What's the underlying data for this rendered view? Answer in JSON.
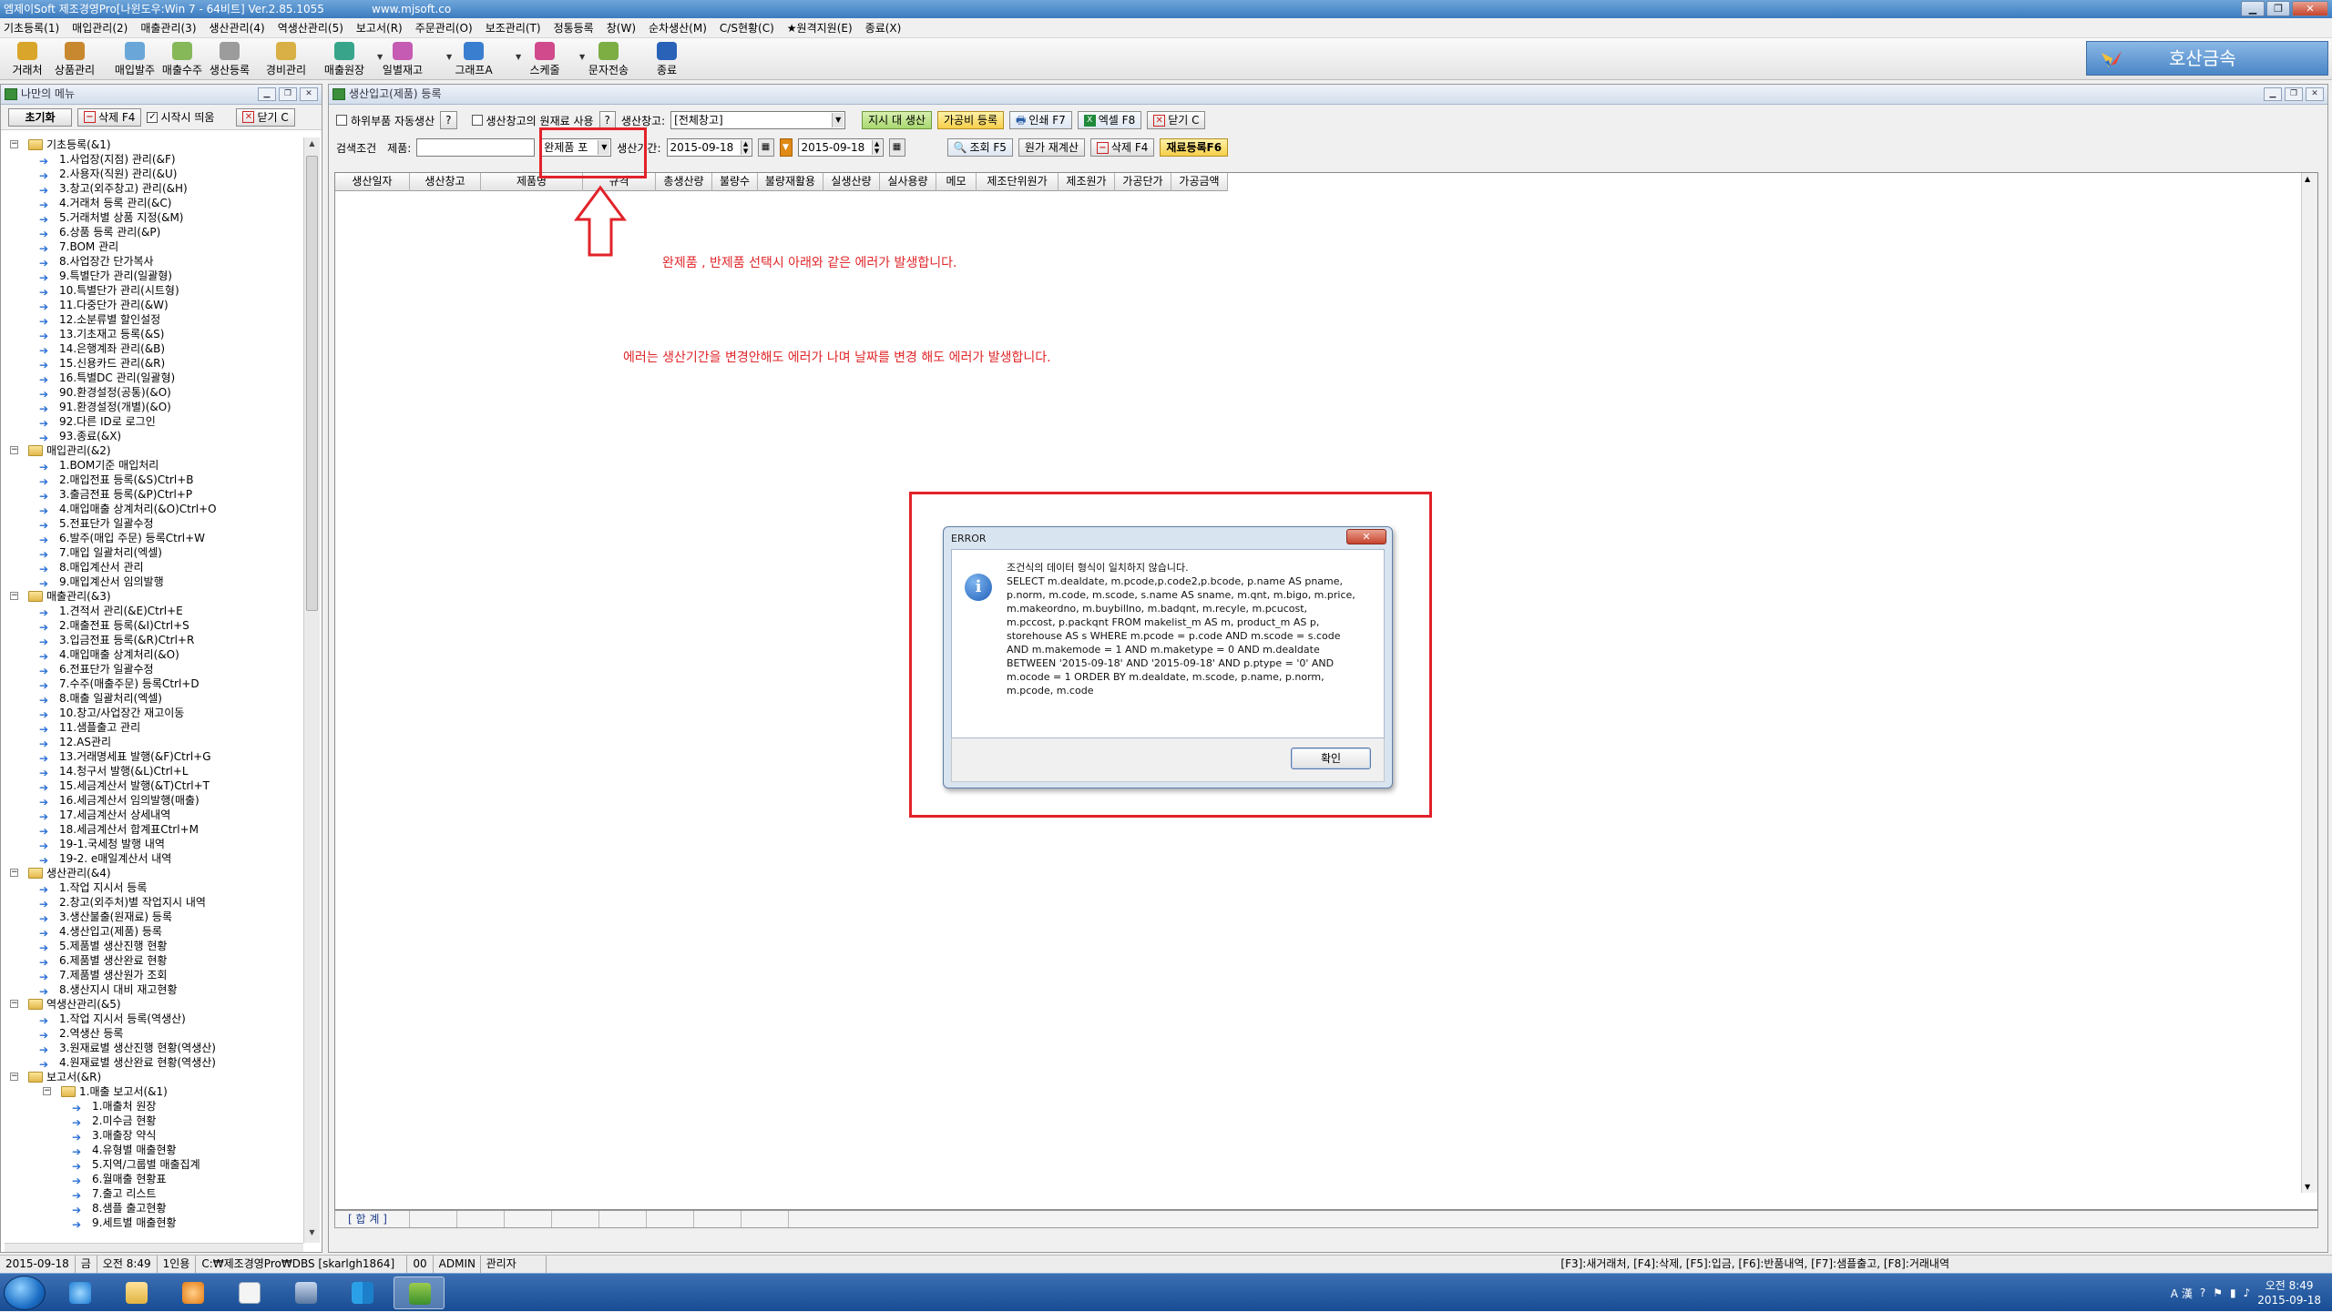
{
  "titlebar": {
    "title": "엠제이Soft 제조경영Pro[나윈도우:Win 7 - 64비트]  Ver.2.85.1055",
    "url": "www.mjsoft.co"
  },
  "menu": [
    "기초등록(1)",
    "매입관리(2)",
    "매출관리(3)",
    "생산관리(4)",
    "역생산관리(5)",
    "보고서(R)",
    "주문관리(O)",
    "보조관리(T)",
    "정통등록",
    "창(W)",
    "순차생산(M)",
    "C/S현황(C)",
    "★원격지원(E)",
    "종료(X)"
  ],
  "toolbar": {
    "buttons": [
      {
        "label": "거래처",
        "icon": "handshake-icon",
        "color": "#d9a52a"
      },
      {
        "label": "상품관리",
        "icon": "box-icon",
        "color": "#c8882f"
      },
      {
        "label": "매입발주",
        "icon": "purchase-icon",
        "color": "#6aa7d8"
      },
      {
        "label": "매출수주",
        "icon": "sales-icon",
        "color": "#86b85a"
      },
      {
        "label": "생산등록",
        "icon": "production-icon",
        "color": "#9c9c9c"
      },
      {
        "label": "경비관리",
        "icon": "expense-icon",
        "color": "#d8b046"
      },
      {
        "label": "매출원장",
        "icon": "ledger-icon",
        "color": "#38a58a"
      },
      {
        "label": "일별재고",
        "icon": "inventory-icon",
        "color": "#c55bb3"
      },
      {
        "label": "그래프A",
        "icon": "graph-icon",
        "color": "#3a7ed0"
      },
      {
        "label": "스케줄",
        "icon": "schedule-icon",
        "color": "#d04a8c"
      },
      {
        "label": "문자전송",
        "icon": "sms-icon",
        "color": "#7cae44"
      },
      {
        "label": "종료",
        "icon": "exit-icon",
        "color": "#2a62b8"
      }
    ],
    "company": "호산금속"
  },
  "leftpanel": {
    "title": "나만의 메뉴",
    "reset_label": "초기화",
    "delete_label": "삭제 F4",
    "startup_label": "시작시 띄움",
    "close_label": "닫기 C"
  },
  "tree": [
    {
      "d": 0,
      "t": "기초등록(&1)",
      "f": 1,
      "e": "−"
    },
    {
      "d": 1,
      "t": "1.사업장(지점) 관리(&F)"
    },
    {
      "d": 1,
      "t": "2.사용자(직원) 관리(&U)"
    },
    {
      "d": 1,
      "t": "3.창고(외주창고) 관리(&H)"
    },
    {
      "d": 1,
      "t": "4.거래처 등록 관리(&C)"
    },
    {
      "d": 1,
      "t": "5.거래처별 상품 지정(&M)"
    },
    {
      "d": 1,
      "t": "6.상품 등록 관리(&P)"
    },
    {
      "d": 1,
      "t": "7.BOM 관리"
    },
    {
      "d": 1,
      "t": "8.사업장간 단가복사"
    },
    {
      "d": 1,
      "t": "9.특별단가 관리(일괄형)"
    },
    {
      "d": 1,
      "t": "10.특별단가 관리(시트형)"
    },
    {
      "d": 1,
      "t": "11.다중단가 관리(&W)"
    },
    {
      "d": 1,
      "t": "12.소분류별 할인설정"
    },
    {
      "d": 1,
      "t": "13.기초재고 등록(&S)"
    },
    {
      "d": 1,
      "t": "14.은행계좌 관리(&B)"
    },
    {
      "d": 1,
      "t": "15.신용카드 관리(&R)"
    },
    {
      "d": 1,
      "t": "16.특별DC 관리(일괄형)"
    },
    {
      "d": 1,
      "t": "90.환경설정(공통)(&O)"
    },
    {
      "d": 1,
      "t": "91.환경설정(개별)(&O)"
    },
    {
      "d": 1,
      "t": "92.다른 ID로 로그인"
    },
    {
      "d": 1,
      "t": "93.종료(&X)"
    },
    {
      "d": 0,
      "t": "매입관리(&2)",
      "f": 1,
      "e": "−"
    },
    {
      "d": 1,
      "t": "1.BOM기준 매입처리"
    },
    {
      "d": 1,
      "t": "2.매입전표 등록(&S)Ctrl+B"
    },
    {
      "d": 1,
      "t": "3.출금전표 등록(&P)Ctrl+P"
    },
    {
      "d": 1,
      "t": "4.매입매출 상계처리(&O)Ctrl+O"
    },
    {
      "d": 1,
      "t": "5.전표단가 일괄수정"
    },
    {
      "d": 1,
      "t": "6.발주(매입 주문) 등록Ctrl+W"
    },
    {
      "d": 1,
      "t": "7.매입 일괄처리(엑셀)"
    },
    {
      "d": 1,
      "t": "8.매입계산서 관리"
    },
    {
      "d": 1,
      "t": "9.매입계산서 임의발행"
    },
    {
      "d": 0,
      "t": "매출관리(&3)",
      "f": 1,
      "e": "−"
    },
    {
      "d": 1,
      "t": "1.견적서 관리(&E)Ctrl+E"
    },
    {
      "d": 1,
      "t": "2.매출전표 등록(&I)Ctrl+S"
    },
    {
      "d": 1,
      "t": "3.입금전표 등록(&R)Ctrl+R"
    },
    {
      "d": 1,
      "t": "4.매입매출 상계처리(&O)"
    },
    {
      "d": 1,
      "t": "6.전표단가 일괄수정"
    },
    {
      "d": 1,
      "t": "7.수주(매출주문) 등록Ctrl+D"
    },
    {
      "d": 1,
      "t": "8.매출 일괄처리(엑셀)"
    },
    {
      "d": 1,
      "t": "10.창고/사업장간 재고이동"
    },
    {
      "d": 1,
      "t": "11.샘플출고 관리"
    },
    {
      "d": 1,
      "t": "12.AS관리"
    },
    {
      "d": 1,
      "t": "13.거래명세표 발행(&F)Ctrl+G"
    },
    {
      "d": 1,
      "t": "14.청구서 발행(&L)Ctrl+L"
    },
    {
      "d": 1,
      "t": "15.세금계산서 발행(&T)Ctrl+T"
    },
    {
      "d": 1,
      "t": "16.세금계산서 임의발행(매출)"
    },
    {
      "d": 1,
      "t": "17.세금계산서 상세내역"
    },
    {
      "d": 1,
      "t": "18.세금계산서 합계표Ctrl+M"
    },
    {
      "d": 1,
      "t": "19-1.국세청 발행 내역"
    },
    {
      "d": 1,
      "t": "19-2. e매일계산서 내역"
    },
    {
      "d": 0,
      "t": "생산관리(&4)",
      "f": 1,
      "e": "−"
    },
    {
      "d": 1,
      "t": "1.작업 지시서 등록"
    },
    {
      "d": 1,
      "t": "2.창고(외주처)별 작업지시 내역"
    },
    {
      "d": 1,
      "t": "3.생산불출(원재료) 등록"
    },
    {
      "d": 1,
      "t": "4.생산입고(제품) 등록"
    },
    {
      "d": 1,
      "t": "5.제품별 생산진행 현황"
    },
    {
      "d": 1,
      "t": "6.제품별 생산완료 현황"
    },
    {
      "d": 1,
      "t": "7.제품별 생산원가 조회"
    },
    {
      "d": 1,
      "t": "8.생산지시 대비 재고현황"
    },
    {
      "d": 0,
      "t": "역생산관리(&5)",
      "f": 1,
      "e": "−"
    },
    {
      "d": 1,
      "t": "1.작업 지시서 등록(역생산)"
    },
    {
      "d": 1,
      "t": "2.역생산 등록"
    },
    {
      "d": 1,
      "t": "3.원재료별 생산진행 현황(역생산)"
    },
    {
      "d": 1,
      "t": "4.원재료별 생산완료 현황(역생산)"
    },
    {
      "d": 0,
      "t": "보고서(&R)",
      "f": 1,
      "e": "−"
    },
    {
      "d": 1,
      "t": "1.매출 보고서(&1)",
      "f": 1,
      "e": "−"
    },
    {
      "d": 2,
      "t": "1.매출처 원장"
    },
    {
      "d": 2,
      "t": "2.미수금 현황"
    },
    {
      "d": 2,
      "t": "3.매출장 약식"
    },
    {
      "d": 2,
      "t": "4.유형별  매출현황"
    },
    {
      "d": 2,
      "t": "5.지역/그룹별 매출집계"
    },
    {
      "d": 2,
      "t": "6.월매출 현황표"
    },
    {
      "d": 2,
      "t": "7.출고 리스트"
    },
    {
      "d": 2,
      "t": "8.샘플 출고현황"
    },
    {
      "d": 2,
      "t": "9.세트별 매출현황"
    }
  ],
  "rightwin": {
    "title": "생산입고(제품) 등록",
    "sub_auto_label": "하위부품 자동생산",
    "q_label": "?",
    "warehouse_raw_label": "생산창고의 원재료 사용",
    "warehouse_label": "생산창고:",
    "warehouse_value": "[전체창고]",
    "btn_order_prod": "지시 대 생산",
    "btn_process_cost": "가공비 등록",
    "btn_print": "인쇄 F7",
    "btn_excel": "엑셀 F8",
    "btn_close": "닫기 C",
    "search_label": "검색조건",
    "product_label": "제품:",
    "product_type_value": "완제품 포",
    "period_label": "생산기간:",
    "date_from": "2015-09-18",
    "date_to": "2015-09-18",
    "btn_search": "조회 F5",
    "btn_recalc": "원가 재계산",
    "btn_delete": "삭제 F4",
    "btn_material": "재료등록F6"
  },
  "columns": [
    {
      "label": "생산일자",
      "w": 82
    },
    {
      "label": "생산창고",
      "w": 78
    },
    {
      "label": "제품명",
      "w": 112
    },
    {
      "label": "규격",
      "w": 80
    },
    {
      "label": "총생산량",
      "w": 62
    },
    {
      "label": "불량수",
      "w": 50
    },
    {
      "label": "불량재활용",
      "w": 72
    },
    {
      "label": "실생산량",
      "w": 62
    },
    {
      "label": "실사용량",
      "w": 62
    },
    {
      "label": "메모",
      "w": 44
    },
    {
      "label": "제조단위원가",
      "w": 90
    },
    {
      "label": "제조원가",
      "w": 62
    },
    {
      "label": "가공단가",
      "w": 62
    },
    {
      "label": "가공금액",
      "w": 62
    }
  ],
  "footer_label": "[ 합 계 ]",
  "notes": {
    "line1": "완제품 , 반제품 선택시 아래와 같은 에러가 발생합니다.",
    "line2": "에러는 생산기간을 변경안해도  에러가 나며  날짜를 변경 해도 에러가 발생합니다."
  },
  "error_dialog": {
    "title": "ERROR",
    "message": "조건식의 데이터 형식이 일치하지 않습니다.\nSELECT m.dealdate, m.pcode,p.code2,p.bcode, p.name AS pname,\np.norm, m.code, m.scode, s.name AS sname, m.qnt, m.bigo, m.price,\nm.makeordno, m.buybillno, m.badqnt, m.recyle, m.pcucost,\nm.pccost, p.packqnt FROM makelist_m AS m, product_m AS p,\nstorehouse AS s WHERE m.pcode = p.code AND m.scode = s.code\nAND m.makemode = 1 AND m.maketype = 0 AND m.dealdate\nBETWEEN '2015-09-18' AND '2015-09-18' AND p.ptype = '0'  AND\nm.ocode = 1 ORDER BY m.dealdate, m.scode, p.name, p.norm,\nm.pcode, m.code",
    "ok_label": "확인"
  },
  "status": {
    "date": "2015-09-18",
    "weekday": "금",
    "time": "오전 8:49",
    "users": "1인용",
    "db": "C:₩제조경영Pro₩DBS [skarlgh1864]",
    "num": "00",
    "user": "ADMIN",
    "role": "관리자",
    "hotkeys": "[F3]:새거래처, [F4]:삭제, [F5]:입금, [F6]:반품내역, [F7]:샘플출고, [F8]:거래내역"
  },
  "tray": {
    "ime": "A 漢",
    "time": "오전 8:49",
    "date": "2015-09-18"
  }
}
